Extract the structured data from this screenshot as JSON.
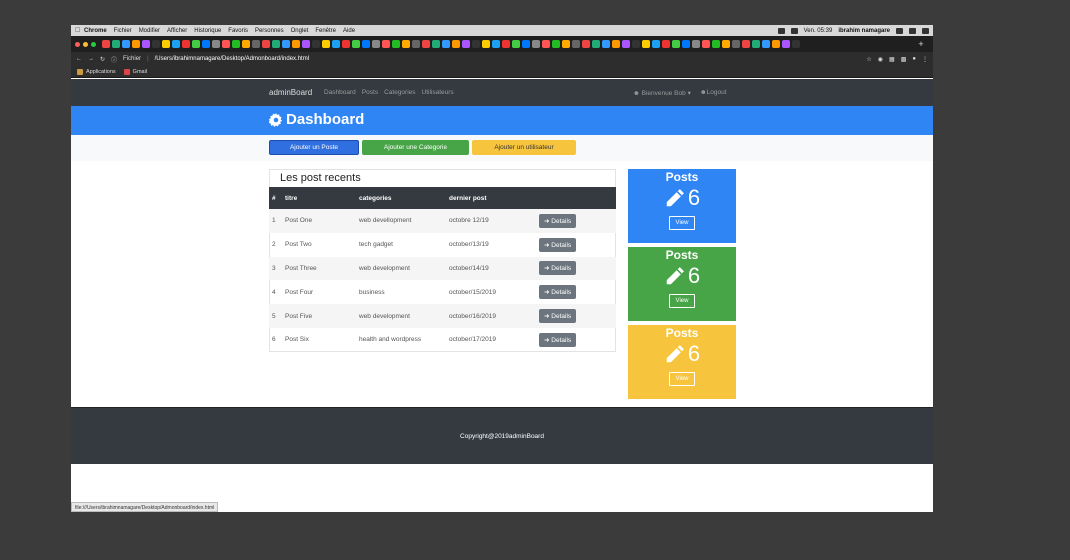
{
  "menubar": {
    "items": [
      "Chrome",
      "Fichier",
      "Modifier",
      "Afficher",
      "Historique",
      "Favoris",
      "Personnes",
      "Onglet",
      "Fenêtre",
      "Aide"
    ],
    "clock": "Ven. 05:39",
    "user": "ibrahim namagare"
  },
  "browser": {
    "url_label": "Fichier",
    "url": "/Users/ibrahimnamagare/Desktop/Admonboard/index.html",
    "bookmarks": [
      "Applications",
      "Gmail"
    ],
    "status_url": "file:///Users/ibrahimnamagare/Desktop/Admonboard/index.html"
  },
  "nav": {
    "brand": "adminBoard",
    "links": [
      "Dashboard",
      "Posts",
      "Categories",
      "Utilisateurs"
    ],
    "welcome": "Bienvenue Bob",
    "logout": "Logout"
  },
  "hero": {
    "title": "Dashboard"
  },
  "actions": {
    "add_post": "Ajouter un Poste",
    "add_category": "Ajouter une Categorie",
    "add_user": "Ajouter un utilisateur"
  },
  "recent": {
    "title": "Les post recents",
    "headers": [
      "#",
      "titre",
      "categories",
      "dernier post",
      ""
    ],
    "details_label": "Details",
    "rows": [
      {
        "n": "1",
        "title": "Post One",
        "category": "web devellopment",
        "date": "octobre 12/19"
      },
      {
        "n": "2",
        "title": "Post Two",
        "category": "tech gadget",
        "date": "october/13/19"
      },
      {
        "n": "3",
        "title": "Post Three",
        "category": "web development",
        "date": "october/14/19"
      },
      {
        "n": "4",
        "title": "Post Four",
        "category": "business",
        "date": "october/15/2019"
      },
      {
        "n": "5",
        "title": "Post Five",
        "category": "web development",
        "date": "october/16/2019"
      },
      {
        "n": "6",
        "title": "Post Six",
        "category": "health and wordpress",
        "date": "october/17/2019"
      }
    ]
  },
  "stats": [
    {
      "title": "Posts",
      "value": "6",
      "button": "View",
      "color": "#3085f4"
    },
    {
      "title": "Posts",
      "value": "6",
      "button": "View",
      "color": "#47a548"
    },
    {
      "title": "Posts",
      "value": "6",
      "button": "View",
      "color": "#f7c43e"
    }
  ],
  "footer": {
    "copyright": "Copyright@2019adminBoard"
  }
}
